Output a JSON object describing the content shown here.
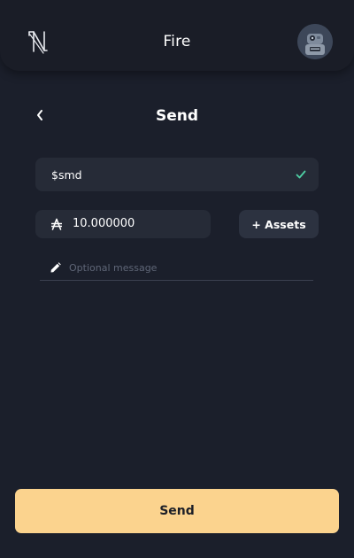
{
  "header": {
    "title": "Fire",
    "logo_icon": "n-logo-icon",
    "avatar_icon": "robot-avatar-icon"
  },
  "send_form": {
    "title": "Send",
    "back_icon": "chevron-left-icon",
    "recipient": {
      "value": "$smd",
      "status_icon": "check-icon"
    },
    "amount": {
      "currency_icon": "currency-a-icon",
      "value": "10.000000"
    },
    "assets_button_label": "+ Assets",
    "message": {
      "icon": "pencil-icon",
      "placeholder": "Optional message",
      "value": ""
    },
    "send_button_label": "Send"
  },
  "colors": {
    "background": "#1b1f2b",
    "field": "#262b37",
    "accent": "#fbd38e",
    "check": "#4fd1a5"
  }
}
